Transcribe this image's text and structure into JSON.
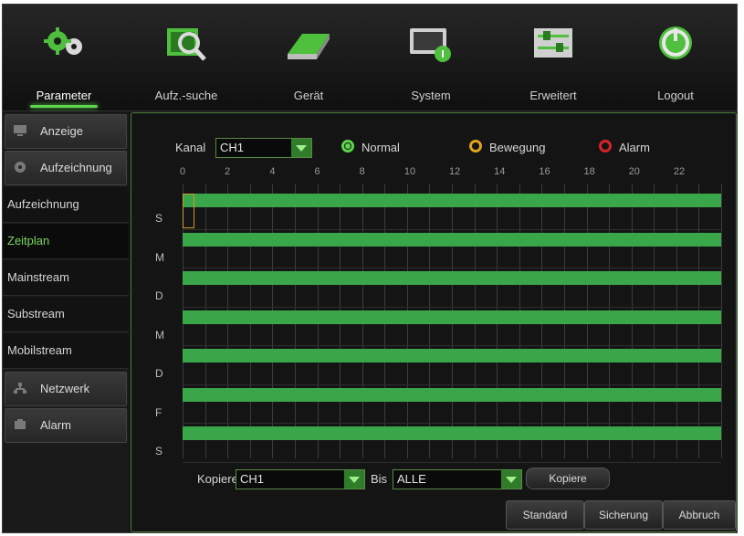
{
  "nav": {
    "items": [
      {
        "label": "Parameter",
        "icon": "gears-icon"
      },
      {
        "label": "Aufz.-suche",
        "icon": "search-film-icon"
      },
      {
        "label": "Gerät",
        "icon": "hdd-icon"
      },
      {
        "label": "System",
        "icon": "system-info-icon"
      },
      {
        "label": "Erweitert",
        "icon": "sliders-icon"
      },
      {
        "label": "Logout",
        "icon": "power-icon"
      }
    ],
    "active_index": 0
  },
  "sidebar": {
    "anzeige": "Anzeige",
    "aufzeichnung_group": "Aufzeichnung",
    "sub": [
      "Aufzeichnung",
      "Zeitplan",
      "Mainstream",
      "Substream",
      "Mobilstream"
    ],
    "active_sub": "Zeitplan",
    "netzwerk": "Netzwerk",
    "alarm": "Alarm"
  },
  "schedule": {
    "kanal_label": "Kanal",
    "kanal_value": "CH1",
    "legend": [
      {
        "label": "Normal",
        "color": "#5fd44d",
        "selected": true
      },
      {
        "label": "Bewegung",
        "color": "#e0a21c",
        "selected": false
      },
      {
        "label": "Alarm",
        "color": "#d9232a",
        "selected": false
      }
    ],
    "hours": [
      "0",
      "2",
      "4",
      "6",
      "8",
      "10",
      "12",
      "14",
      "16",
      "18",
      "20",
      "22"
    ],
    "days": [
      "S",
      "M",
      "D",
      "M",
      "D",
      "F",
      "S"
    ],
    "bar_color": "#3aa64a",
    "coverage_fraction": 1.0
  },
  "copy": {
    "kopiere_label": "Kopiere",
    "from_value": "CH1",
    "bis_label": "Bis",
    "to_value": "ALLE",
    "button_label": "Kopiere"
  },
  "footer": {
    "standard": "Standard",
    "sicherung": "Sicherung",
    "abbruch": "Abbruch"
  }
}
